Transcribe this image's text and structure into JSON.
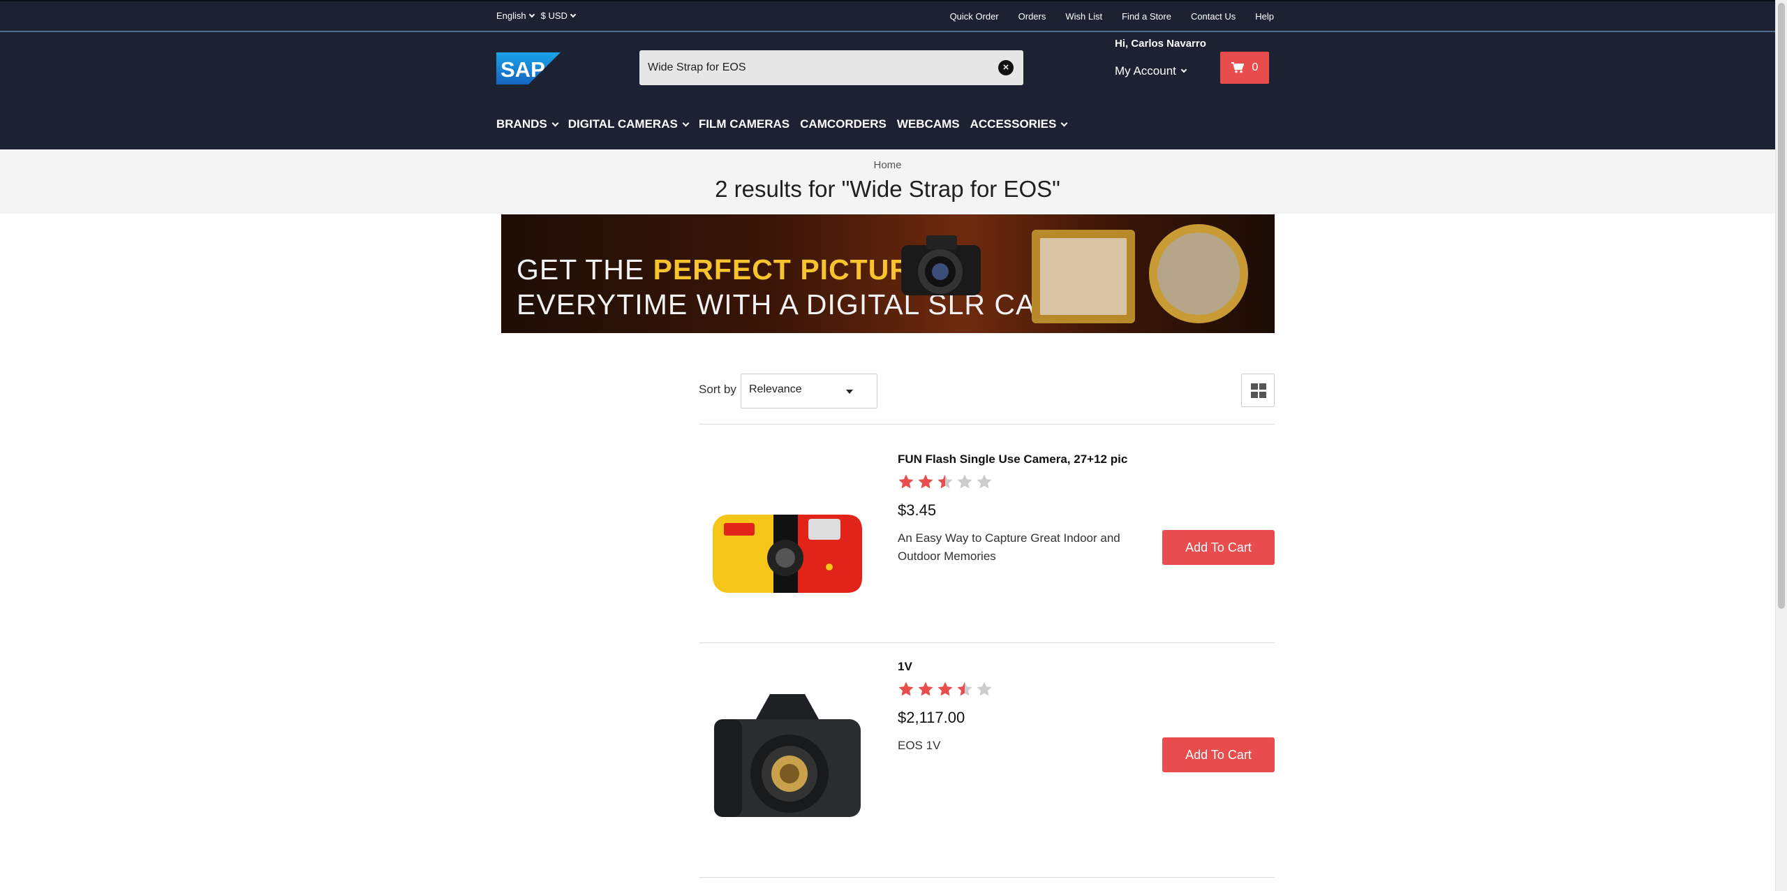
{
  "topbar": {
    "language": "English",
    "currency": "$ USD",
    "links": [
      "Quick Order",
      "Orders",
      "Wish List",
      "Find a Store",
      "Contact Us",
      "Help"
    ]
  },
  "header": {
    "logo_text": "SAP",
    "search_value": "Wide Strap for EOS",
    "search_clear_icon": "close-circle-icon",
    "greeting": "Hi, Carlos Navarro",
    "my_account": "My Account",
    "cart_count": "0",
    "cart_icon": "shopping-cart-icon"
  },
  "nav": {
    "items": [
      {
        "label": "BRANDS",
        "has_dropdown": true
      },
      {
        "label": "DIGITAL CAMERAS",
        "has_dropdown": true
      },
      {
        "label": "FILM CAMERAS",
        "has_dropdown": false
      },
      {
        "label": "CAMCORDERS",
        "has_dropdown": false
      },
      {
        "label": "WEBCAMS",
        "has_dropdown": false
      },
      {
        "label": "ACCESSORIES",
        "has_dropdown": true
      }
    ]
  },
  "breadcrumb": "Home",
  "results_title": "2 results for \"Wide Strap for EOS\"",
  "banner": {
    "line1_a": "GET THE ",
    "line1_b": "PERFECT PICTURE",
    "line2": "EVERYTIME WITH A DIGITAL SLR CAMERA"
  },
  "sort": {
    "label": "Sort by",
    "selected": "Relevance"
  },
  "view_toggle_icon": "grid-view-icon",
  "colors": {
    "header_bg": "#1c2232",
    "accent": "#e94c4c",
    "star_on": "#e94c4c",
    "star_off": "#cccccc"
  },
  "products": [
    {
      "name": "FUN Flash Single Use Camera, 27+12 pic",
      "rating": 2.5,
      "price": "$3.45",
      "description": "An Easy Way to Capture Great Indoor and Outdoor Memories",
      "button": "Add To Cart",
      "image_icon": "disposable-camera-image"
    },
    {
      "name": "1V",
      "rating": 3.5,
      "price": "$2,117.00",
      "description": "EOS 1V",
      "button": "Add To Cart",
      "image_icon": "slr-camera-image"
    }
  ]
}
